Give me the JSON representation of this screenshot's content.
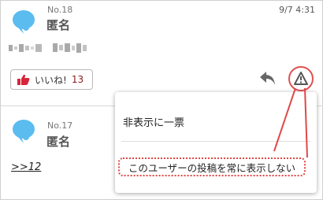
{
  "posts": [
    {
      "number": "No.18",
      "author": "匿名",
      "timestamp": "9/7 4:31",
      "like": {
        "label": "いいね!",
        "count": "13"
      }
    },
    {
      "number": "No.17",
      "author": "匿名",
      "anchor_link": ">>12"
    }
  ],
  "popup": {
    "hide_label": "非表示に一票",
    "always_hide_label": "このユーザーの投稿を常に表示しない"
  },
  "icons": {
    "avatar": "bird-avatar-icon",
    "like": "thumbs-up-icon",
    "reply": "reply-arrow-icon",
    "report": "warning-triangle-icon"
  },
  "colors": {
    "avatar_blue": "#5bbcef",
    "like_red": "#d6253a",
    "highlight_red": "#e04848"
  }
}
